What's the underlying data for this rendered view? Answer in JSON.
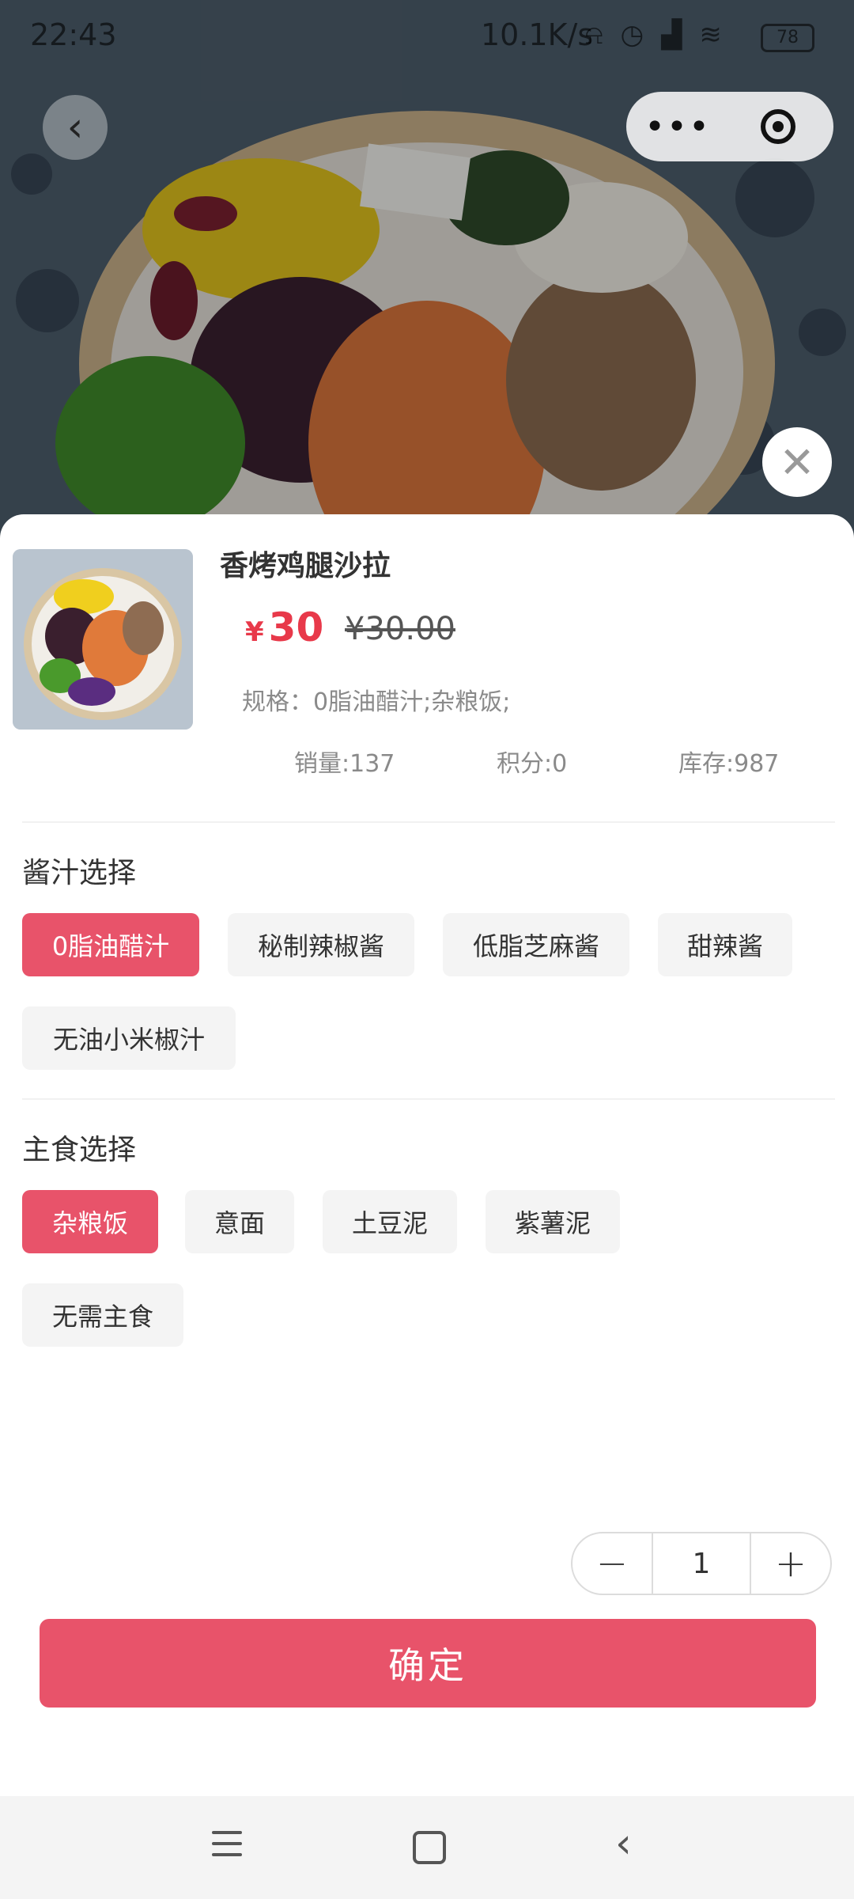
{
  "status_bar": {
    "time": "22:43",
    "network_speed": "10.1K/s",
    "battery": "78"
  },
  "capsule": {
    "more_glyph": "•••"
  },
  "product": {
    "name": "香烤鸡腿沙拉",
    "currency": "¥",
    "price": "30",
    "original_price": "¥30.00",
    "spec": "规格：0脂油醋汁;杂粮饭;",
    "sales": "销量:137",
    "points": "积分:0",
    "stock": "库存:987"
  },
  "sauce": {
    "title": "酱汁选择",
    "options": [
      "0脂油醋汁",
      "秘制辣椒酱",
      "低脂芝麻酱",
      "甜辣酱",
      "无油小米椒汁"
    ],
    "selected": "0脂油醋汁"
  },
  "staple": {
    "title": "主食选择",
    "options": [
      "杂粮饭",
      "意面",
      "土豆泥",
      "紫薯泥",
      "无需主食"
    ],
    "selected": "杂粮饭"
  },
  "quantity": {
    "minus": "−",
    "value": "1",
    "plus": "+"
  },
  "confirm_label": "确定",
  "colors": {
    "accent": "#e8536a",
    "price": "#e8394a"
  },
  "icons": [
    "back-icon",
    "more-icon",
    "target-icon",
    "close-icon",
    "menu-icon",
    "home-icon",
    "nav-back-icon"
  ]
}
